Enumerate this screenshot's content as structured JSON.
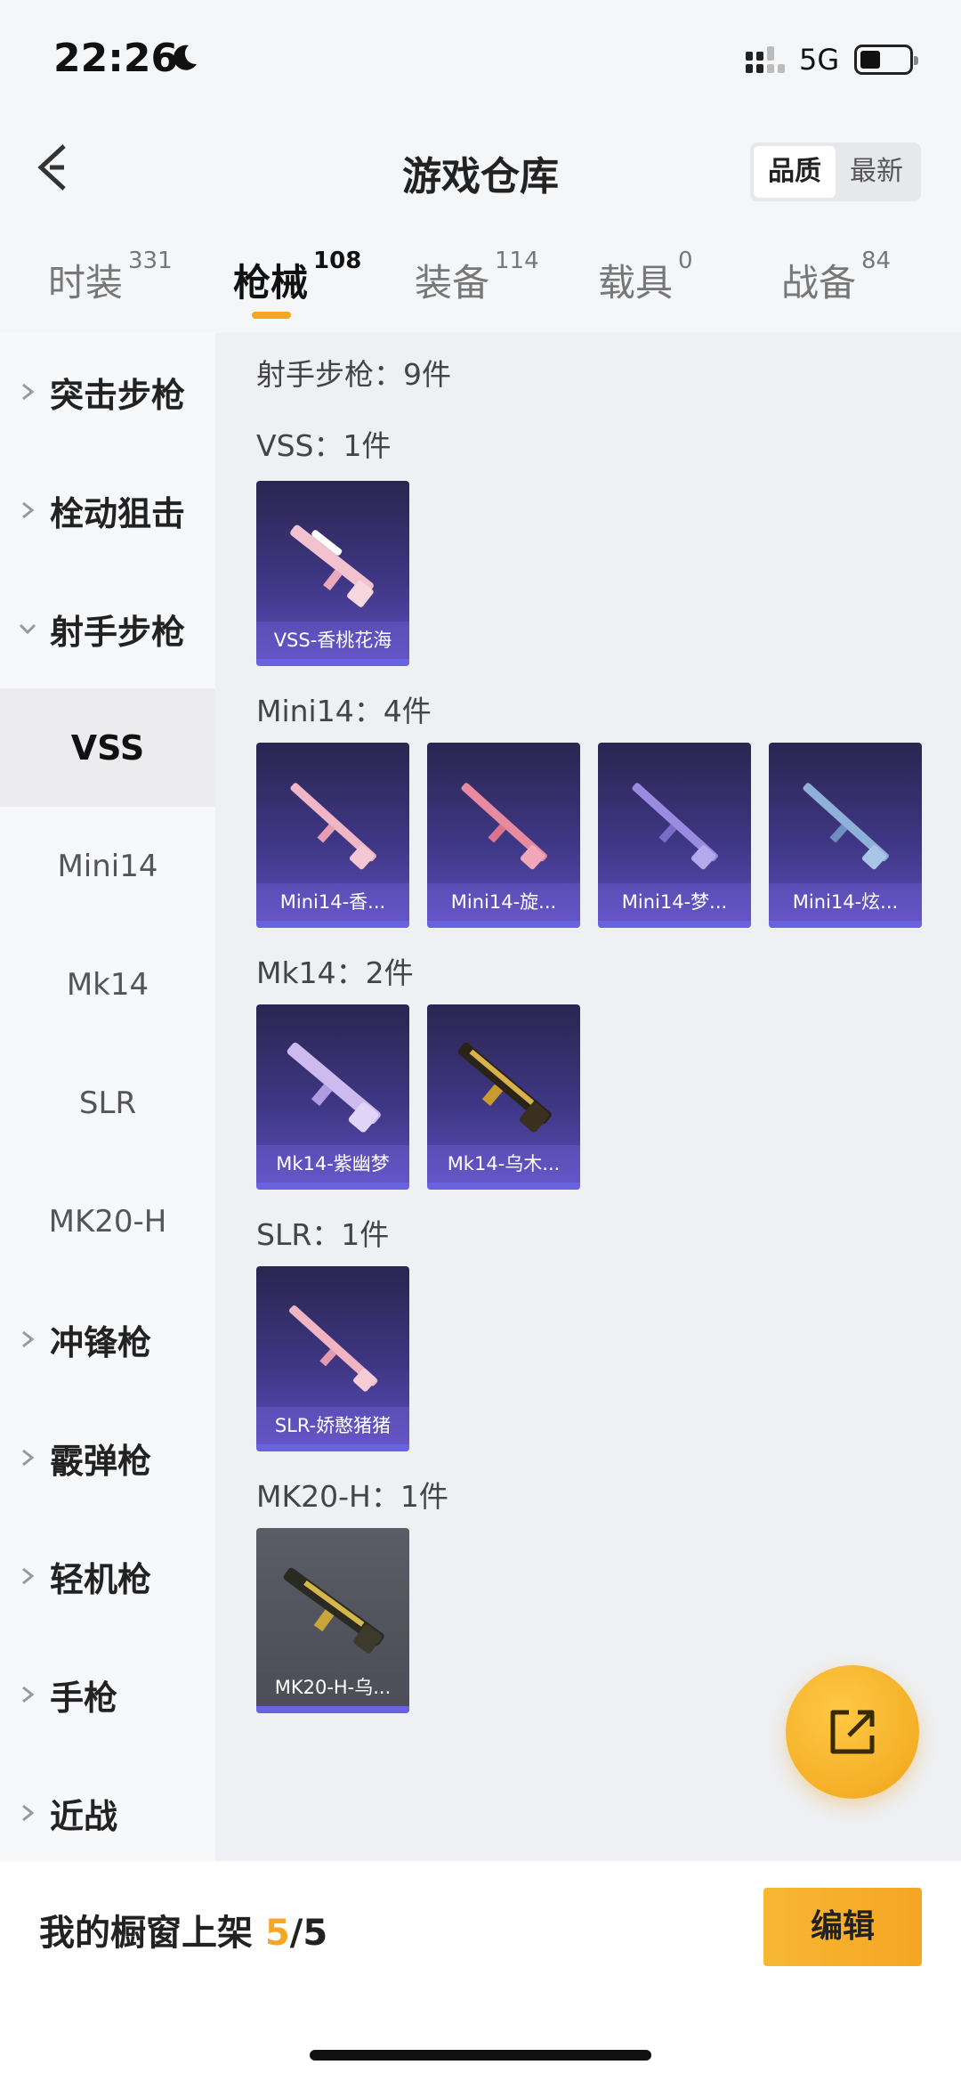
{
  "status": {
    "time": "22:26",
    "network": "5G"
  },
  "header": {
    "title": "游戏仓库",
    "sort_options": [
      "品质",
      "最新"
    ]
  },
  "tabs": [
    {
      "label": "时装",
      "count": "331"
    },
    {
      "label": "枪械",
      "count": "108"
    },
    {
      "label": "装备",
      "count": "114"
    },
    {
      "label": "载具",
      "count": "0"
    },
    {
      "label": "战备",
      "count": "84"
    }
  ],
  "sidebar": {
    "items": [
      {
        "label": "突击步枪"
      },
      {
        "label": "栓动狙击"
      },
      {
        "label": "射手步枪"
      },
      {
        "label": "VSS"
      },
      {
        "label": "Mini14"
      },
      {
        "label": "Mk14"
      },
      {
        "label": "SLR"
      },
      {
        "label": "MK20-H"
      },
      {
        "label": "冲锋枪"
      },
      {
        "label": "霰弹枪"
      },
      {
        "label": "轻机枪"
      },
      {
        "label": "手枪"
      },
      {
        "label": "近战"
      }
    ]
  },
  "content": {
    "category_title": "射手步枪：9件",
    "sections": [
      {
        "title": "VSS：1件",
        "items": [
          "VSS-香桃花海"
        ]
      },
      {
        "title": "Mini14：4件",
        "items": [
          "Mini14-香...",
          "Mini14-旋...",
          "Mini14-梦...",
          "Mini14-炫..."
        ]
      },
      {
        "title": "Mk14：2件",
        "items": [
          "Mk14-紫幽梦",
          "Mk14-乌木..."
        ]
      },
      {
        "title": "SLR：1件",
        "items": [
          "SLR-娇憨猪猪"
        ]
      },
      {
        "title": "MK20-H：1件",
        "items": [
          "MK20-H-乌..."
        ]
      }
    ]
  },
  "bottom": {
    "showcase_label": "我的橱窗上架 ",
    "showcase_count": "5",
    "showcase_total": "/5",
    "edit_label": "编辑"
  },
  "colors": {
    "accent": "#f5a623",
    "card_bar": "#6a63e0"
  }
}
